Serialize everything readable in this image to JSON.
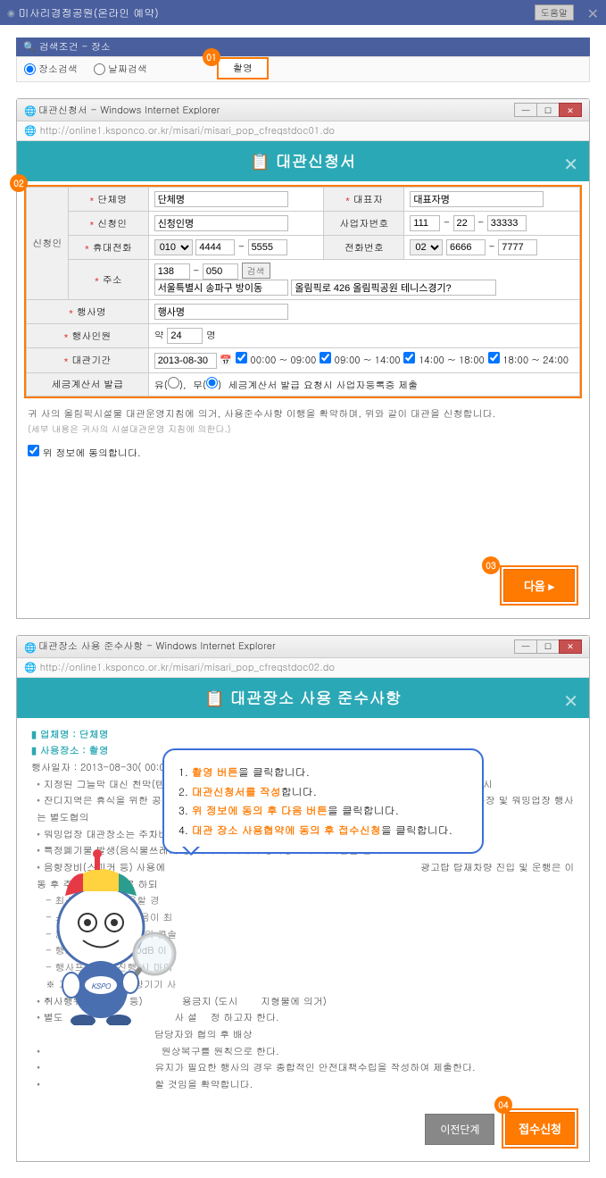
{
  "app": {
    "title": "미사리경정공원(온라인 예약)",
    "help": "도움말"
  },
  "search": {
    "title": "검색조건  - 장소",
    "place_radio": "장소검색",
    "date_radio": "날짜검색",
    "selected_value": "촬영"
  },
  "markers": {
    "m1": "01",
    "m2": "02",
    "m3": "03",
    "m4": "04"
  },
  "win1": {
    "title": "대관신청서 - Windows Internet Explorer",
    "url": "http://online1.ksponco.or.kr/misari/misari_pop_cfreqstdoc01.do",
    "doc_title": "대관신청서"
  },
  "form": {
    "applicant_head": "신청인",
    "org_label": "단체명",
    "org_value": "단체명",
    "rep_label": "대표자",
    "rep_value": "대표자명",
    "name_label": "신청인",
    "name_value": "신청인명",
    "biz_label": "사업자번호",
    "biz1": "111",
    "biz2": "22",
    "biz3": "33333",
    "mobile_label": "휴대전화",
    "mobile_pfx": "010",
    "mobile1": "4444",
    "mobile2": "5555",
    "phone_label": "전화번호",
    "phone_pfx": "02",
    "phone1": "6666",
    "phone2": "7777",
    "addr_label": "주소",
    "zip1": "138",
    "zip2": "050",
    "addr_btn": "검색",
    "addr1": "서울특별시 송파구 방이동",
    "addr2": "올림픽로 426 올림픽공원 테니스경기?",
    "event_label": "행사명",
    "event_value": "행사명",
    "people_label": "행사인원",
    "people_pre": "약",
    "people_value": "24",
    "people_post": "명",
    "period_label": "대관기간",
    "period_date": "2013-08-30",
    "slot1": "00:00 ~ 09:00",
    "slot2": "09:00 ~ 14:00",
    "slot3": "14:00 ~ 18:00",
    "slot4": "18:00 ~ 24:00",
    "tax_label": "세금계산서 발급",
    "tax_yes": "유(   ),",
    "tax_no": "무(   )",
    "tax_tail": "세금계산서 발급 요청시 사업자등록증 제출"
  },
  "note1": {
    "line1": "귀 사의 올림픽시설물 대관운영지침에 의거, 사용준수사항 이행을 확약하며, 위와 같이 대관을 신청합니다.",
    "line2": "(세부 내용은 귀사의 시설대관운영 지침에 의한다.)",
    "agree": "위 정보에 동의합니다."
  },
  "buttons": {
    "next": "다음 ▸",
    "prev": "이전단계",
    "submit": "접수신청"
  },
  "win2": {
    "title": "대관장소 사용 준수사항 - Windows Internet Explorer",
    "url": "http://online1.ksponco.or.kr/misari/misari_pop_cfreqstdoc02.do",
    "doc_title": "대관장소 사용 준수사항"
  },
  "rules": {
    "org_line": "업체명 : 단체명",
    "place_line": "사용장소 : 촬영",
    "date_line": "행사일자 : 2013-08-30( 00:00 ~ 09:00 , 09:00 ~ 14:00 , 14:00 ~ 18:00 , 18:00 ~ 24:00 )",
    "r1": "지정된 그늘막 대신 천막(텐트 포함) 설치는 잔디보호를 위해 금지, 단 원활한 행사진행을 위해 필요 시",
    "r2": "잔디지역은 휴식을 위한 공간이므로, 축구, 공놀이, 줄다리기, 에어바운스 등은 금지하고 있으며 축구장 및 워밍업장 행사는 별도협의",
    "r3": "워밍업장 대관장소는 주차비를 일괄정산 하는 것을 원칙으로 한다.",
    "r4": "특정폐기물 발생(음식물쓰레기 등)시 주최 측에서 행사종료 후 즉시반출 원칙",
    "r5h": "음향장비(스피커 등) 사용에",
    "r5t": "광고탑 탑재차량 진입 및 운행은 이동 후 주차를 원칙으로 하되",
    "r5a": "- 최소음향으로 사용할 경",
    "r5b": "- 스피커의 방향은 소음이 최",
    "r5c": "- 음향장비(마이크 등)의 콘솔",
    "r5d": "- 행사장 주변 : 약 70dB 이",
    "r5e": "- 행사프로그램 진행 시 마이",
    "r5f": "기준을 넘어선 음향기기 사",
    "r6h": "취사행위(화기사용 등)",
    "r6a": "용금지 (도시",
    "r6b": " 지형물에 의거)",
    "r7a": "별도",
    "r7b": "사 설",
    "r7c": "정 하고자 한다.",
    "r7d": "담당자와 협의 후 배상",
    "r8": "원상복구를 원칙으로 한다.",
    "r9": "유지가 필요한 행사의 경우 종합적인 안전대책수립을 작성하여 제출한다.",
    "r10": "할 것임을 확약합니다."
  },
  "bubble": {
    "l1a": "1. ",
    "l1b": "촬영 버튼",
    "l1c": "을 클릭합니다.",
    "l2a": "2. ",
    "l2b": "대관신청서를 작성",
    "l2c": "합니다.",
    "l3a": "3. ",
    "l3b": "위 정보에 동의 후 다음 버튼",
    "l3c": "을 클릭합니다.",
    "l4a": "4. ",
    "l4b": "대관 장소 사용협약에 동의 후 접수신청",
    "l4c": "을 클릭합니다."
  }
}
